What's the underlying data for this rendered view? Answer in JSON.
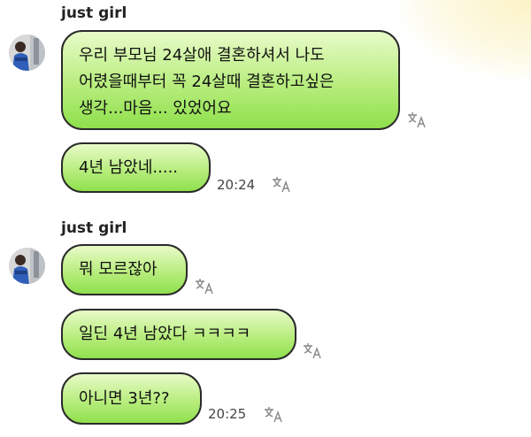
{
  "groups": [
    {
      "sender": "just girl",
      "messages": [
        {
          "text": "우리 부모님 24살애 결혼하셔서 나도\n어렸을때부터 꼭 24살때 결혼하고싶은\n생각...마음... 있었어요",
          "time": ""
        },
        {
          "text": "4년 남았네.....",
          "time": "20:24"
        }
      ]
    },
    {
      "sender": "just girl",
      "messages": [
        {
          "text": "뭐 모르잖아",
          "time": ""
        },
        {
          "text": "일딘 4년 남았다 ㅋㅋㅋㅋ",
          "time": ""
        },
        {
          "text": "아니면 3년??",
          "time": "20:25"
        }
      ]
    }
  ],
  "icons": {
    "translate": "translate-icon",
    "avatar": "avatar-photo"
  },
  "colors": {
    "bubble_top": "#e8fbc8",
    "bubble_bottom": "#8fe04d",
    "bubble_border": "#2a2a2a"
  }
}
